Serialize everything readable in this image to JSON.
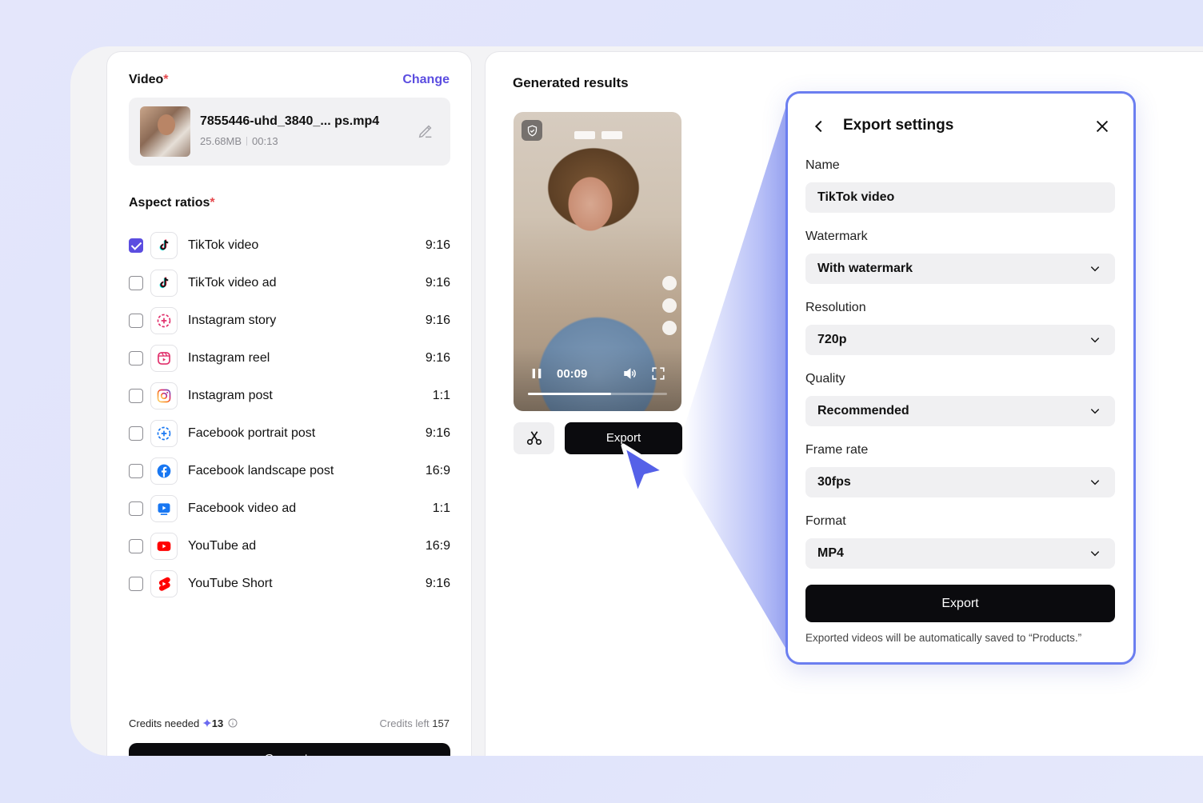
{
  "left": {
    "video_title": "Video",
    "required_mark": "*",
    "change_label": "Change",
    "file": {
      "name": "7855446-uhd_3840_... ps.mp4",
      "size": "25.68MB",
      "duration": "00:13"
    },
    "aspect_title": "Aspect ratios",
    "ratios": [
      {
        "label": "TikTok video",
        "ratio": "9:16",
        "checked": true,
        "icon": "tiktok-icon"
      },
      {
        "label": "TikTok video ad",
        "ratio": "9:16",
        "checked": false,
        "icon": "tiktok-icon"
      },
      {
        "label": "Instagram story",
        "ratio": "9:16",
        "checked": false,
        "icon": "instagram-story-icon"
      },
      {
        "label": "Instagram reel",
        "ratio": "9:16",
        "checked": false,
        "icon": "instagram-reel-icon"
      },
      {
        "label": "Instagram post",
        "ratio": "1:1",
        "checked": false,
        "icon": "instagram-icon"
      },
      {
        "label": "Facebook portrait post",
        "ratio": "9:16",
        "checked": false,
        "icon": "facebook-story-icon"
      },
      {
        "label": "Facebook landscape post",
        "ratio": "16:9",
        "checked": false,
        "icon": "facebook-icon"
      },
      {
        "label": "Facebook video ad",
        "ratio": "1:1",
        "checked": false,
        "icon": "facebook-video-icon"
      },
      {
        "label": "YouTube ad",
        "ratio": "16:9",
        "checked": false,
        "icon": "youtube-icon"
      },
      {
        "label": "YouTube Short",
        "ratio": "9:16",
        "checked": false,
        "icon": "youtube-shorts-icon"
      }
    ],
    "credits_needed_label": "Credits needed",
    "credits_needed_value": "13",
    "credits_left_label": "Credits left",
    "credits_left_value": "157",
    "generate_label": "Generate"
  },
  "right": {
    "title": "Generated results",
    "video_time": "00:09",
    "video_progress": 0.6,
    "export_label": "Export"
  },
  "modal": {
    "title": "Export settings",
    "name_label": "Name",
    "name_value": "TikTok video",
    "watermark_label": "Watermark",
    "watermark_value": "With watermark",
    "resolution_label": "Resolution",
    "resolution_value": "720p",
    "quality_label": "Quality",
    "quality_value": "Recommended",
    "framerate_label": "Frame rate",
    "framerate_value": "30fps",
    "format_label": "Format",
    "format_value": "MP4",
    "export_label": "Export",
    "note": "Exported videos will be automatically saved to “Products.”"
  },
  "colors": {
    "accent": "#5b4de0",
    "modal_border": "#6b7ef0",
    "required": "#e5484d"
  }
}
